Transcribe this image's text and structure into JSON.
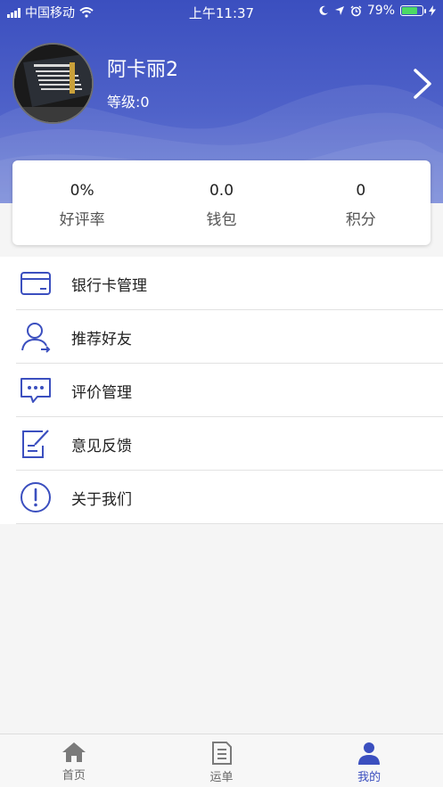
{
  "status_bar": {
    "carrier": "中国移动",
    "time": "上午11:37",
    "battery": "79%",
    "battery_level": 0.79
  },
  "profile": {
    "name": "阿卡丽2",
    "level": "等级:0"
  },
  "stats": [
    {
      "value": "0%",
      "label": "好评率"
    },
    {
      "value": "0.0",
      "label": "钱包"
    },
    {
      "value": "0",
      "label": "积分"
    }
  ],
  "menu": [
    {
      "label": "银行卡管理",
      "icon": "bank-card-icon"
    },
    {
      "label": "推荐好友",
      "icon": "recommend-friend-icon"
    },
    {
      "label": "评价管理",
      "icon": "comment-icon"
    },
    {
      "label": "意见反馈",
      "icon": "feedback-edit-icon"
    },
    {
      "label": "关于我们",
      "icon": "info-exclamation-icon"
    }
  ],
  "tabbar": [
    {
      "label": "首页",
      "icon": "home-icon"
    },
    {
      "label": "运单",
      "icon": "document-icon"
    },
    {
      "label": "我的",
      "icon": "person-icon"
    }
  ],
  "colors": {
    "primary": "#3b4fbf",
    "icon": "#3b4fbf"
  }
}
